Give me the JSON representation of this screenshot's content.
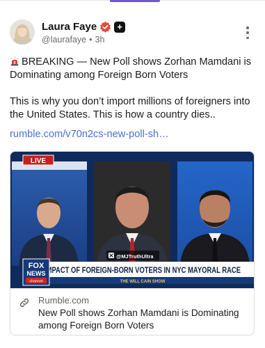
{
  "post": {
    "author_name": "Laura Faye",
    "handle": "@laurafaye",
    "separator": "•",
    "time": "3h",
    "line1": "BREAKING — New Poll shows Zorhan Mamdani is Dominating among Foreign Born Voters",
    "line2": "This is why you don’t import millions of foreigners into the United States. This is how a country dies..",
    "link_text": "rumble.com/v70n2cs-new-poll-sh…"
  },
  "card": {
    "domain": "Rumble.com",
    "title": "New Poll shows Zorhan Mamdani is Dominating among Foreign Born Voters",
    "live_label": "LIVE",
    "watermark": "@MJTruthUltra",
    "fox_logo_top": "FOX",
    "fox_logo_bottom": "NEWS",
    "fox_logo_sub": "channel",
    "chyron": "IMPACT OF FOREIGN-BORN VOTERS IN NYC MAYORAL RACE",
    "show_name": "THE WILL CAIN SHOW"
  },
  "colors": {
    "accent": "#6e55d9",
    "link": "#4c6fd1",
    "verified": "#e34c3a",
    "fox_red": "#d4261d",
    "fox_blue": "#163a78"
  },
  "icons": {
    "siren": "siren-icon",
    "verified": "verified-badge-icon",
    "plus": "plus-badge-icon",
    "more": "more-vertical-icon",
    "link": "link-icon",
    "x_logo": "x-logo-icon"
  }
}
